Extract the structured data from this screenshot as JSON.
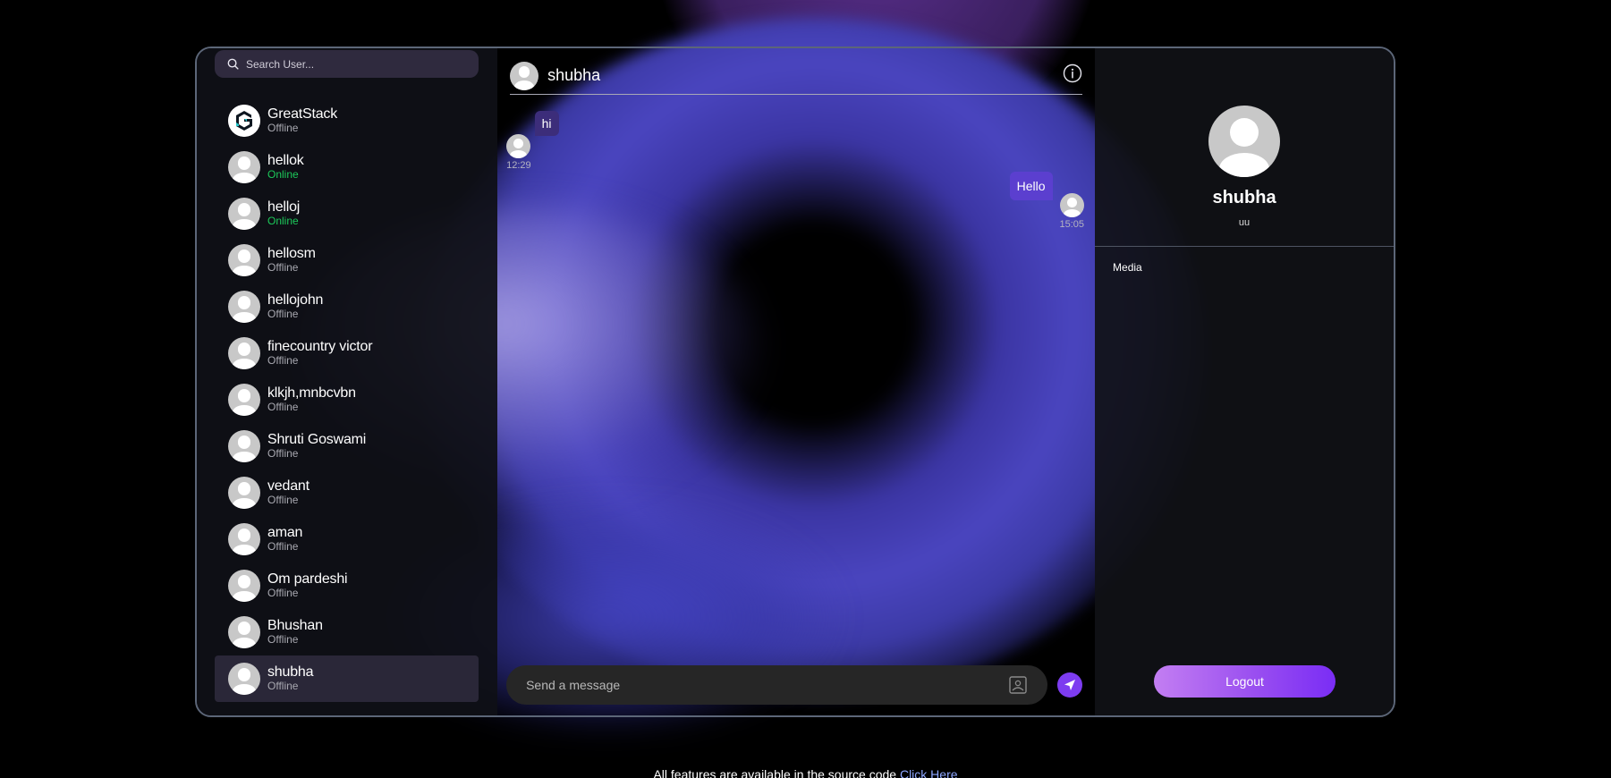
{
  "search": {
    "placeholder": "Search User..."
  },
  "users": [
    {
      "name": "GreatStack",
      "status": "Offline",
      "logo": true
    },
    {
      "name": "hellok",
      "status": "Online"
    },
    {
      "name": "helloj",
      "status": "Online"
    },
    {
      "name": "hellosm",
      "status": "Offline"
    },
    {
      "name": "hellojohn",
      "status": "Offline"
    },
    {
      "name": "finecountry victor",
      "status": "Offline"
    },
    {
      "name": "klkjh,mnbcvbn",
      "status": "Offline"
    },
    {
      "name": "Shruti Goswami",
      "status": "Offline"
    },
    {
      "name": "vedant",
      "status": "Offline"
    },
    {
      "name": "aman",
      "status": "Offline"
    },
    {
      "name": "Om pardeshi",
      "status": "Offline"
    },
    {
      "name": "Bhushan",
      "status": "Offline"
    },
    {
      "name": "shubha",
      "status": "Offline",
      "active": true
    }
  ],
  "chat": {
    "title": "shubha",
    "messages": {
      "incoming": {
        "text": "hi",
        "time": "12:29"
      },
      "outgoing": {
        "text": "Hello",
        "time": "15:05"
      }
    },
    "composer_placeholder": "Send a message"
  },
  "profile": {
    "name": "shubha",
    "bio": "uu",
    "media_label": "Media",
    "logout_label": "Logout"
  },
  "footer": {
    "text": "All features are available in the source code",
    "link_text": "Click Here"
  },
  "colors": {
    "online": "#1cc95a",
    "accent": "#7d3cf0"
  }
}
